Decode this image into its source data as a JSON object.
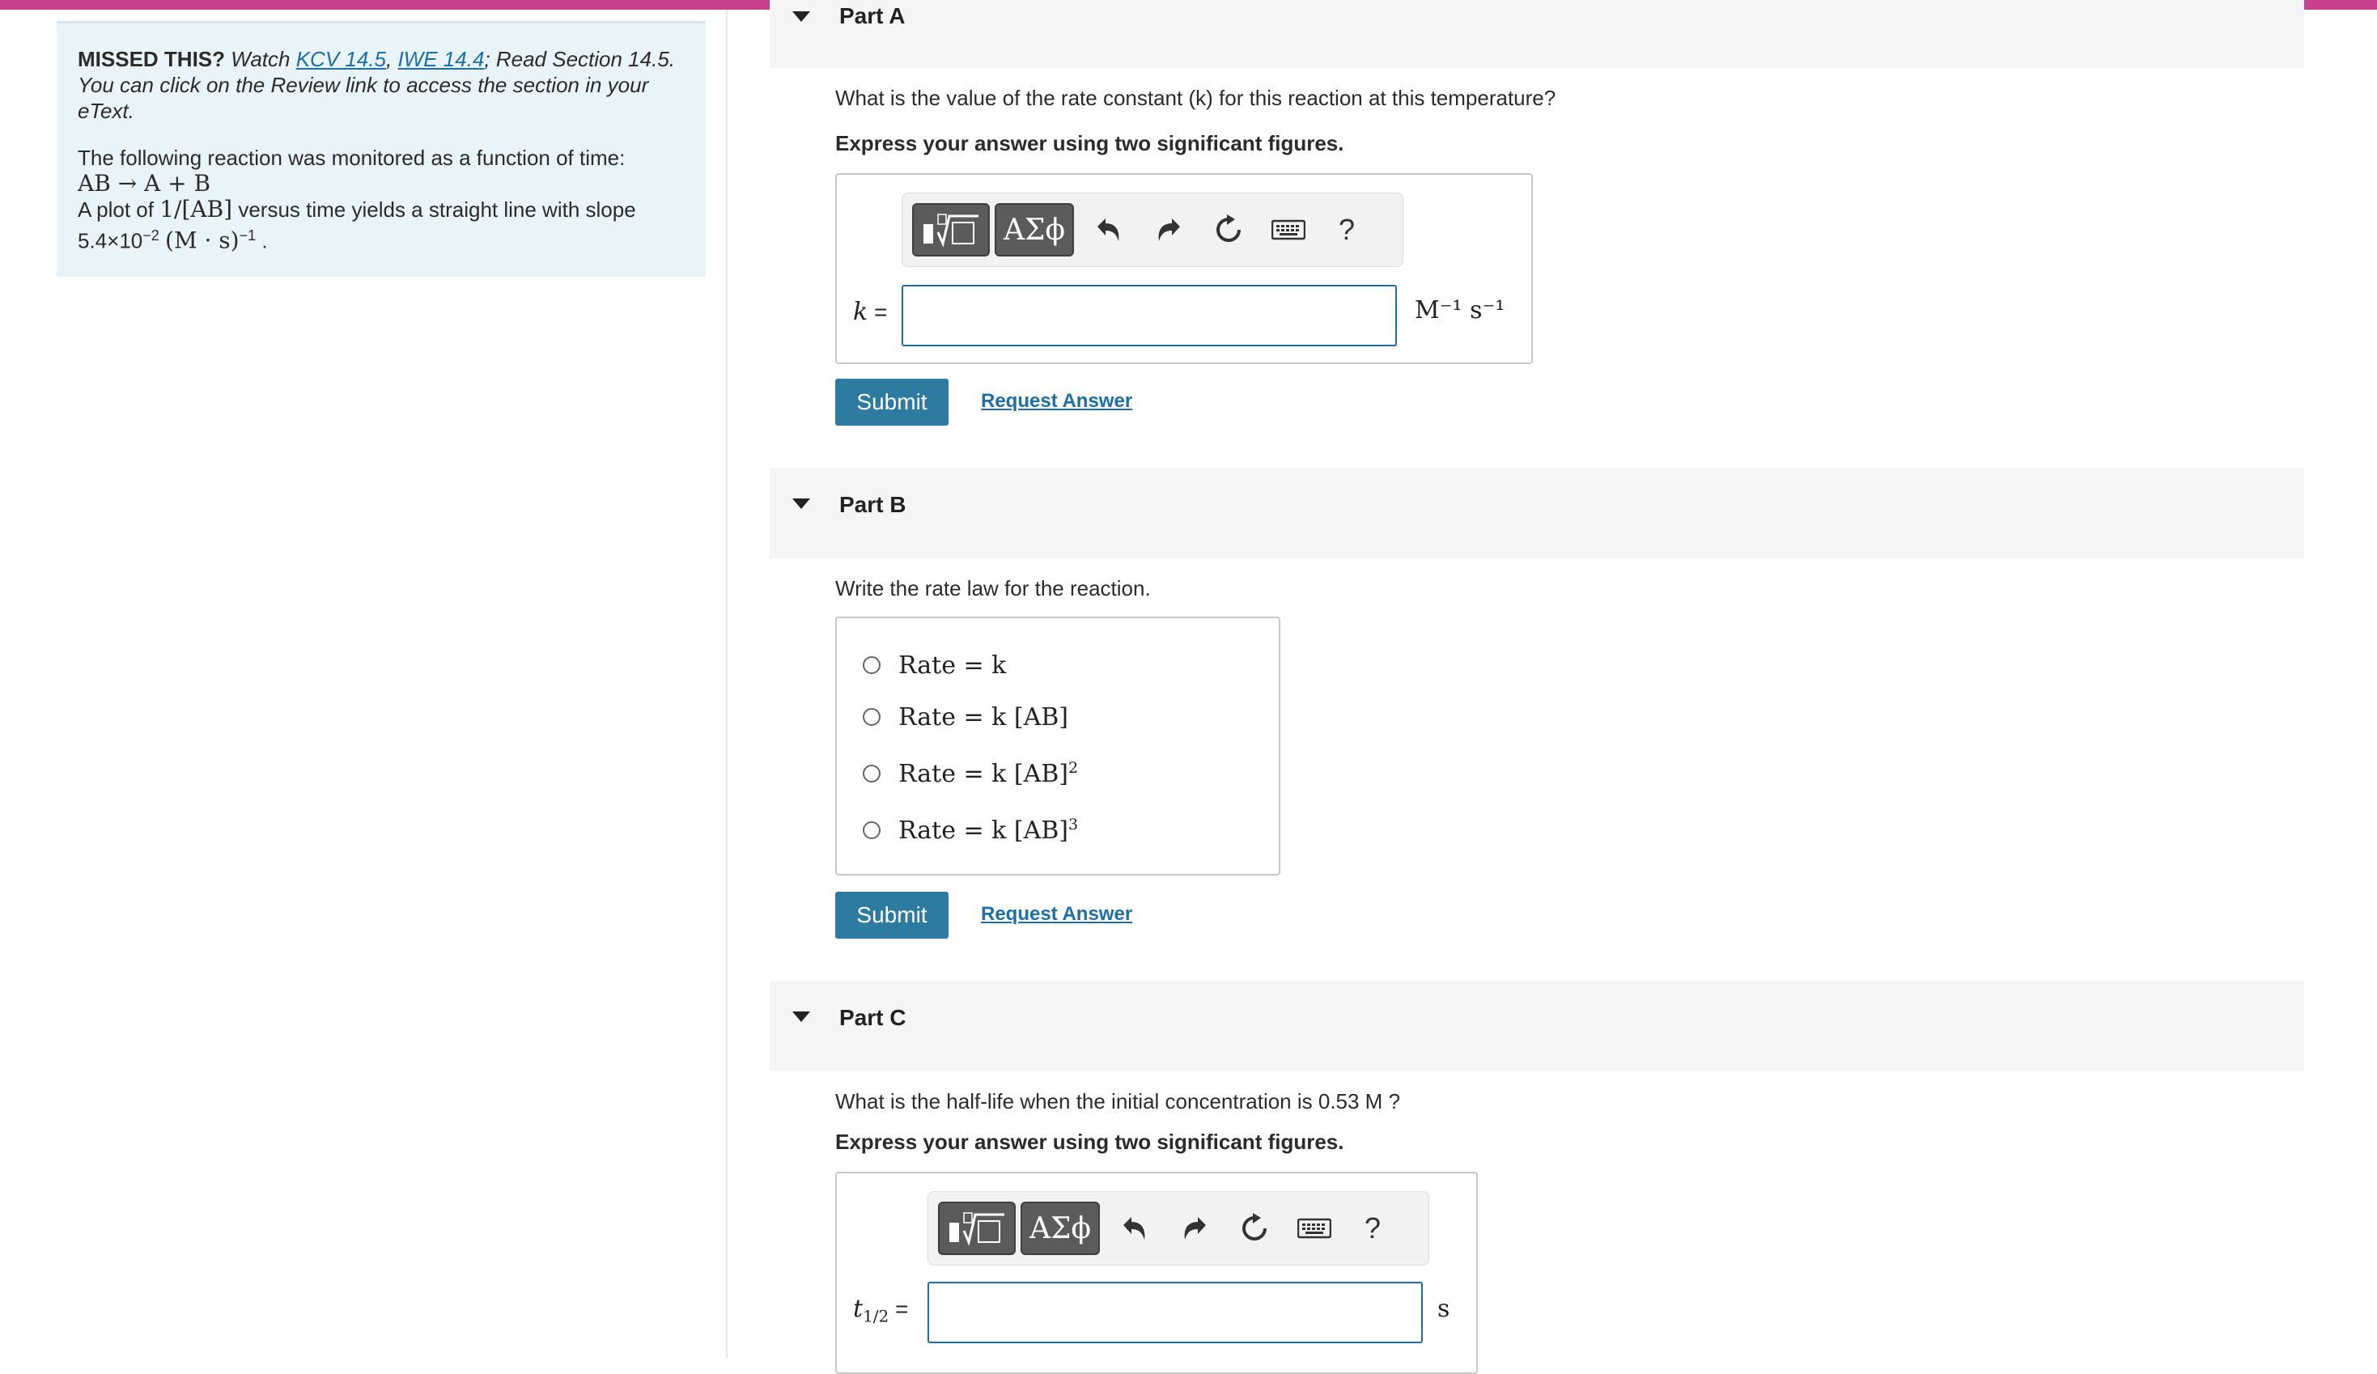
{
  "colors": {
    "accent_top": "#c9408d",
    "info_bg": "#e8f4f7",
    "button_bg": "#2e7ba1",
    "link": "#1d6fa5"
  },
  "info": {
    "missed_label": "MISSED THIS?",
    "watch_text": "Watch",
    "link1": "KCV 14.5",
    "comma": ",",
    "link2": "IWE 14.4",
    "read_text": "; Read Section 14.5.",
    "review_line": "You can click on the Review link to access the section in your eText.",
    "monitored": "The following reaction was monitored as a function of time:",
    "reaction": "AB → A + B",
    "plot_prefix": "A plot of",
    "plot_expr": "1/[AB]",
    "plot_suffix": "versus time yields a straight line with slope",
    "slope_value": "5.4×10",
    "slope_exp": "−2",
    "slope_units": "(M · s)",
    "slope_units_exp": "−1",
    "slope_end": "."
  },
  "partA": {
    "title": "Part A",
    "question": "What is the value of the rate constant (k) for this reaction at this temperature?",
    "instruction": "Express your answer using two significant figures.",
    "var": "k",
    "equals": "=",
    "unit": "M⁻¹ s⁻¹",
    "submit": "Submit",
    "request": "Request Answer",
    "answer_value": ""
  },
  "partB": {
    "title": "Part B",
    "question": "Write the rate law for the reaction.",
    "options": [
      {
        "text": "Rate = k",
        "sup": ""
      },
      {
        "text": "Rate = k [AB]",
        "sup": ""
      },
      {
        "text": "Rate = k [AB]",
        "sup": "2"
      },
      {
        "text": "Rate = k [AB]",
        "sup": "3"
      }
    ],
    "submit": "Submit",
    "request": "Request Answer"
  },
  "partC": {
    "title": "Part C",
    "question": "What is the half-life when the initial concentration is 0.53 M ?",
    "instruction": "Express your answer using two significant figures.",
    "var": "t",
    "var_sub": "1/2",
    "equals": "=",
    "unit": "s",
    "answer_value": ""
  },
  "toolbar": {
    "greek_label": "ΑΣϕ",
    "help_label": "?",
    "icons": [
      "templates-icon",
      "greek-symbols-icon",
      "undo-icon",
      "redo-icon",
      "reset-icon",
      "keyboard-icon",
      "help-icon"
    ]
  }
}
